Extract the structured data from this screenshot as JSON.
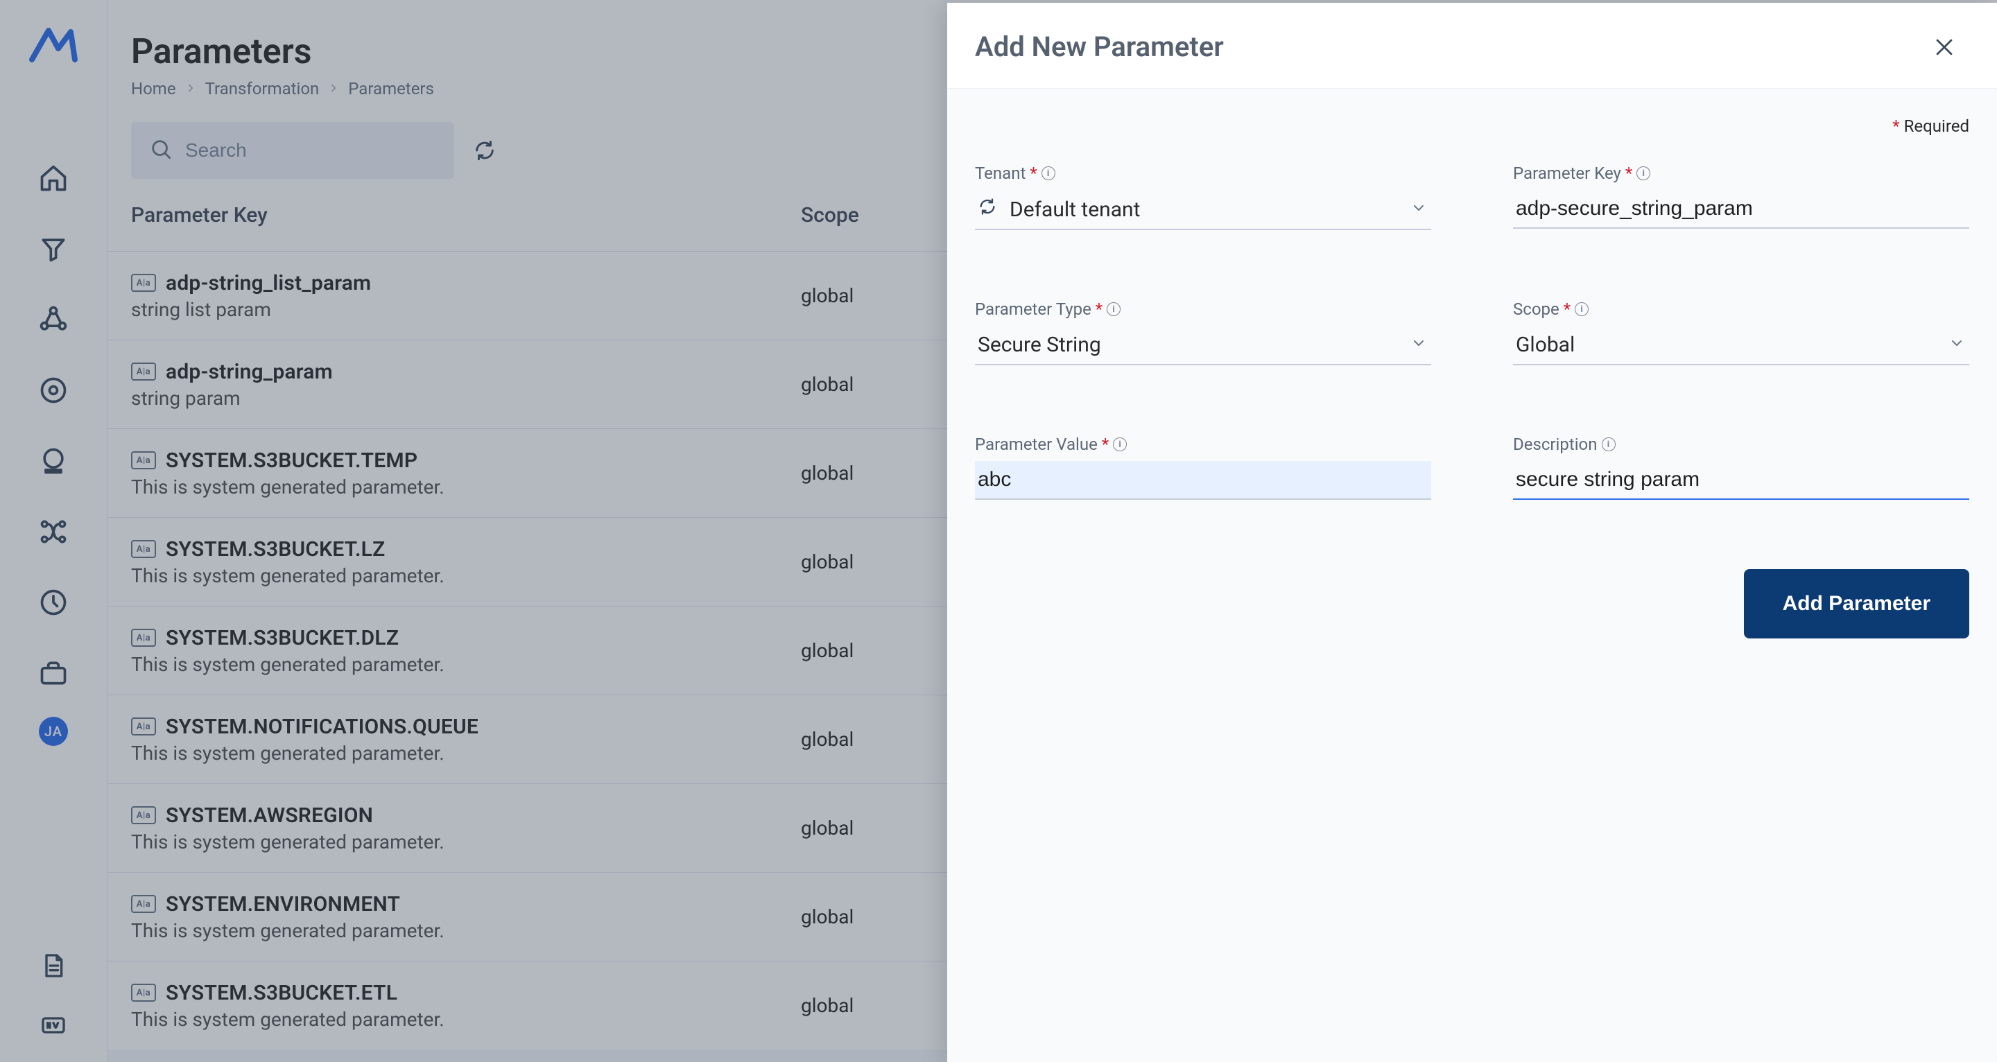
{
  "header": {
    "title": "Parameters",
    "breadcrumb": [
      "Home",
      "Transformation",
      "Parameters"
    ]
  },
  "toolbar": {
    "search_placeholder": "Search"
  },
  "table": {
    "columns": {
      "key": "Parameter Key",
      "scope": "Scope"
    },
    "rows": [
      {
        "key": "adp-string_list_param",
        "desc": "string list param",
        "scope": "global"
      },
      {
        "key": "adp-string_param",
        "desc": "string param",
        "scope": "global"
      },
      {
        "key": "SYSTEM.S3BUCKET.TEMP",
        "desc": "This is system generated parameter.",
        "scope": "global"
      },
      {
        "key": "SYSTEM.S3BUCKET.LZ",
        "desc": "This is system generated parameter.",
        "scope": "global"
      },
      {
        "key": "SYSTEM.S3BUCKET.DLZ",
        "desc": "This is system generated parameter.",
        "scope": "global"
      },
      {
        "key": "SYSTEM.NOTIFICATIONS.QUEUE",
        "desc": "This is system generated parameter.",
        "scope": "global"
      },
      {
        "key": "SYSTEM.AWSREGION",
        "desc": "This is system generated parameter.",
        "scope": "global"
      },
      {
        "key": "SYSTEM.ENVIRONMENT",
        "desc": "This is system generated parameter.",
        "scope": "global"
      },
      {
        "key": "SYSTEM.S3BUCKET.ETL",
        "desc": "This is system generated parameter.",
        "scope": "global"
      }
    ]
  },
  "user": {
    "initials": "JA"
  },
  "panel": {
    "title": "Add New Parameter",
    "required_text": "Required",
    "fields": {
      "tenant": {
        "label": "Tenant",
        "value": "Default tenant"
      },
      "parameter_key": {
        "label": "Parameter Key",
        "value": "adp-secure_string_param"
      },
      "parameter_type": {
        "label": "Parameter Type",
        "value": "Secure String"
      },
      "scope": {
        "label": "Scope",
        "value": "Global"
      },
      "parameter_value": {
        "label": "Parameter Value",
        "value": "abc"
      },
      "description": {
        "label": "Description",
        "value": "secure string param"
      }
    },
    "submit_label": "Add Parameter"
  }
}
